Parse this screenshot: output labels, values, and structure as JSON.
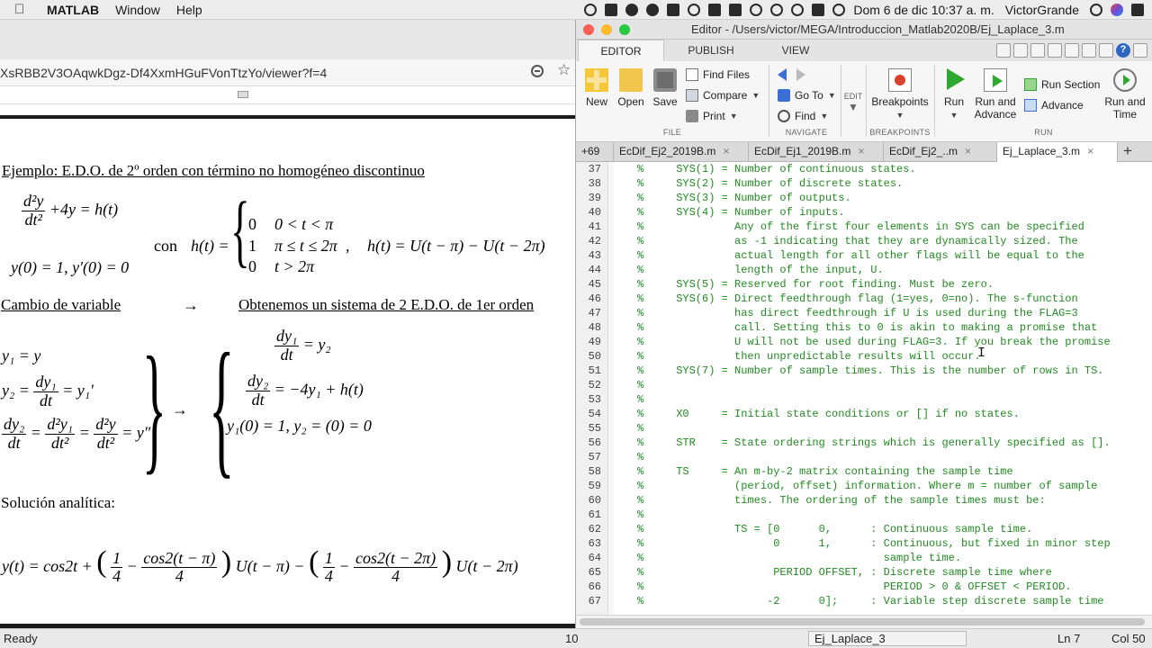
{
  "menubar": {
    "apple_icon": "apple-logo-icon",
    "app_name": "MATLAB",
    "items": [
      "Window",
      "Help"
    ],
    "clock": "Dom 6 de dic  10:37 a. m.",
    "user": "VictorGrande"
  },
  "browser": {
    "url": "XsRBB2V3OAqwkDgz-Df4XxmHGuFVonTtzYo/viewer?f=4"
  },
  "doc": {
    "heading": "Ejemplo: E.D.O. de 2º orden con término no homogéneo discontinuo",
    "con": "con",
    "ode_tail": "+4y = h(t)",
    "ic": "y(0) = 1,    y′(0) = 0",
    "h_def": "h(t) =",
    "case1_val": "0",
    "case1_cond": "0 < t < π",
    "case2_val": "1",
    "case2_cond": "π ≤ t ≤ 2π",
    "case3_val": "0",
    "case3_cond": "t > 2π",
    "comma": ",",
    "h_unit": "h(t) = U(t − π) − U(t − 2π)",
    "cambio": "Cambio de variable",
    "arrow": "→",
    "obtenemos": "Obtenemos un sistema de 2 E.D.O. de 1er orden",
    "y1": "y₁ = y",
    "y2_left": "y₂ =",
    "y2_right": "= y₁′",
    "dy2_right": "= y″",
    "eq1_right": "= y₂",
    "eq2_right": "= −4y₁ + h(t)",
    "ic2": "y₁(0) = 1,    y₂ = (0) = 0",
    "sol_label": "Solución analítica:",
    "sol_lhs": "y(t) = cos2t +",
    "sol_mid1": "U(t − π) −",
    "sol_mid2": "U(t − 2π)",
    "f_d2y": "d²y",
    "f_dt2": "dt²",
    "f_dy1": "dy₁",
    "f_dy2": "dy₂",
    "f_dt": "dt",
    "f_d2y1": "d²y₁",
    "f_1": "1",
    "f_4": "4",
    "f_cos1": "cos2(t − π)",
    "f_cos2": "cos2(t − 2π)"
  },
  "status": {
    "ready": "Ready",
    "divider": "10",
    "file_name": "Ej_Laplace_3",
    "ln": "Ln   7",
    "col": "Col   50"
  },
  "editor": {
    "title": "Editor - /Users/victor/MEGA/Introduccion_Matlab2020B/Ej_Laplace_3.m",
    "toolstrip_tabs": [
      "EDITOR",
      "PUBLISH",
      "VIEW"
    ],
    "ribbon": {
      "new": "New",
      "open": "Open",
      "save": "Save",
      "find_files": "Find Files",
      "compare": "Compare",
      "print": "Print",
      "go_to": "Go To",
      "find": "Find",
      "edit": "EDIT",
      "breakpoints": "Breakpoints",
      "run": "Run",
      "run_and_advance": [
        "Run and",
        "Advance"
      ],
      "run_section": "Run Section",
      "advance": "Advance",
      "run_and_time": [
        "Run and",
        "Time"
      ],
      "groups": {
        "file": "FILE",
        "navigate": "NAVIGATE",
        "breakpoints": "BREAKPOINTS",
        "run": "RUN"
      }
    },
    "file_tabs": {
      "overflow": "+69",
      "tabs": [
        {
          "name": "EcDif_Ej2_2019B.m",
          "active": false
        },
        {
          "name": "EcDif_Ej1_2019B.m",
          "active": false
        },
        {
          "name": "EcDif_Ej2_..m",
          "active": false
        },
        {
          "name": "Ej_Laplace_3.m",
          "active": true
        }
      ],
      "close_glyph": "×",
      "add_glyph": "+"
    },
    "code_lines": [
      {
        "n": "37",
        "t": "%     SYS(1) = Number of continuous states."
      },
      {
        "n": "38",
        "t": "%     SYS(2) = Number of discrete states."
      },
      {
        "n": "39",
        "t": "%     SYS(3) = Number of outputs."
      },
      {
        "n": "40",
        "t": "%     SYS(4) = Number of inputs."
      },
      {
        "n": "41",
        "t": "%              Any of the first four elements in SYS can be specified"
      },
      {
        "n": "42",
        "t": "%              as -1 indicating that they are dynamically sized. The"
      },
      {
        "n": "43",
        "t": "%              actual length for all other flags will be equal to the"
      },
      {
        "n": "44",
        "t": "%              length of the input, U."
      },
      {
        "n": "45",
        "t": "%     SYS(5) = Reserved for root finding. Must be zero."
      },
      {
        "n": "46",
        "t": "%     SYS(6) = Direct feedthrough flag (1=yes, 0=no). The s-function"
      },
      {
        "n": "47",
        "t": "%              has direct feedthrough if U is used during the FLAG=3"
      },
      {
        "n": "48",
        "t": "%              call. Setting this to 0 is akin to making a promise that"
      },
      {
        "n": "49",
        "t": "%              U will not be used during FLAG=3. If you break the promise"
      },
      {
        "n": "50",
        "t": "%              then unpredictable results will occur."
      },
      {
        "n": "51",
        "t": "%     SYS(7) = Number of sample times. This is the number of rows in TS."
      },
      {
        "n": "52",
        "t": "%"
      },
      {
        "n": "53",
        "t": "%"
      },
      {
        "n": "54",
        "t": "%     X0     = Initial state conditions or [] if no states."
      },
      {
        "n": "55",
        "t": "%"
      },
      {
        "n": "56",
        "t": "%     STR    = State ordering strings which is generally specified as []."
      },
      {
        "n": "57",
        "t": "%"
      },
      {
        "n": "58",
        "t": "%     TS     = An m-by-2 matrix containing the sample time"
      },
      {
        "n": "59",
        "t": "%              (period, offset) information. Where m = number of sample"
      },
      {
        "n": "60",
        "t": "%              times. The ordering of the sample times must be:"
      },
      {
        "n": "61",
        "t": "%"
      },
      {
        "n": "62",
        "t": "%              TS = [0      0,      : Continuous sample time."
      },
      {
        "n": "63",
        "t": "%                    0      1,      : Continuous, but fixed in minor step"
      },
      {
        "n": "64",
        "t": "%                                     sample time."
      },
      {
        "n": "65",
        "t": "%                    PERIOD OFFSET, : Discrete sample time where"
      },
      {
        "n": "66",
        "t": "%                                     PERIOD > 0 & OFFSET < PERIOD."
      },
      {
        "n": "67",
        "t": "%                   -2      0];     : Variable step discrete sample time"
      }
    ]
  }
}
